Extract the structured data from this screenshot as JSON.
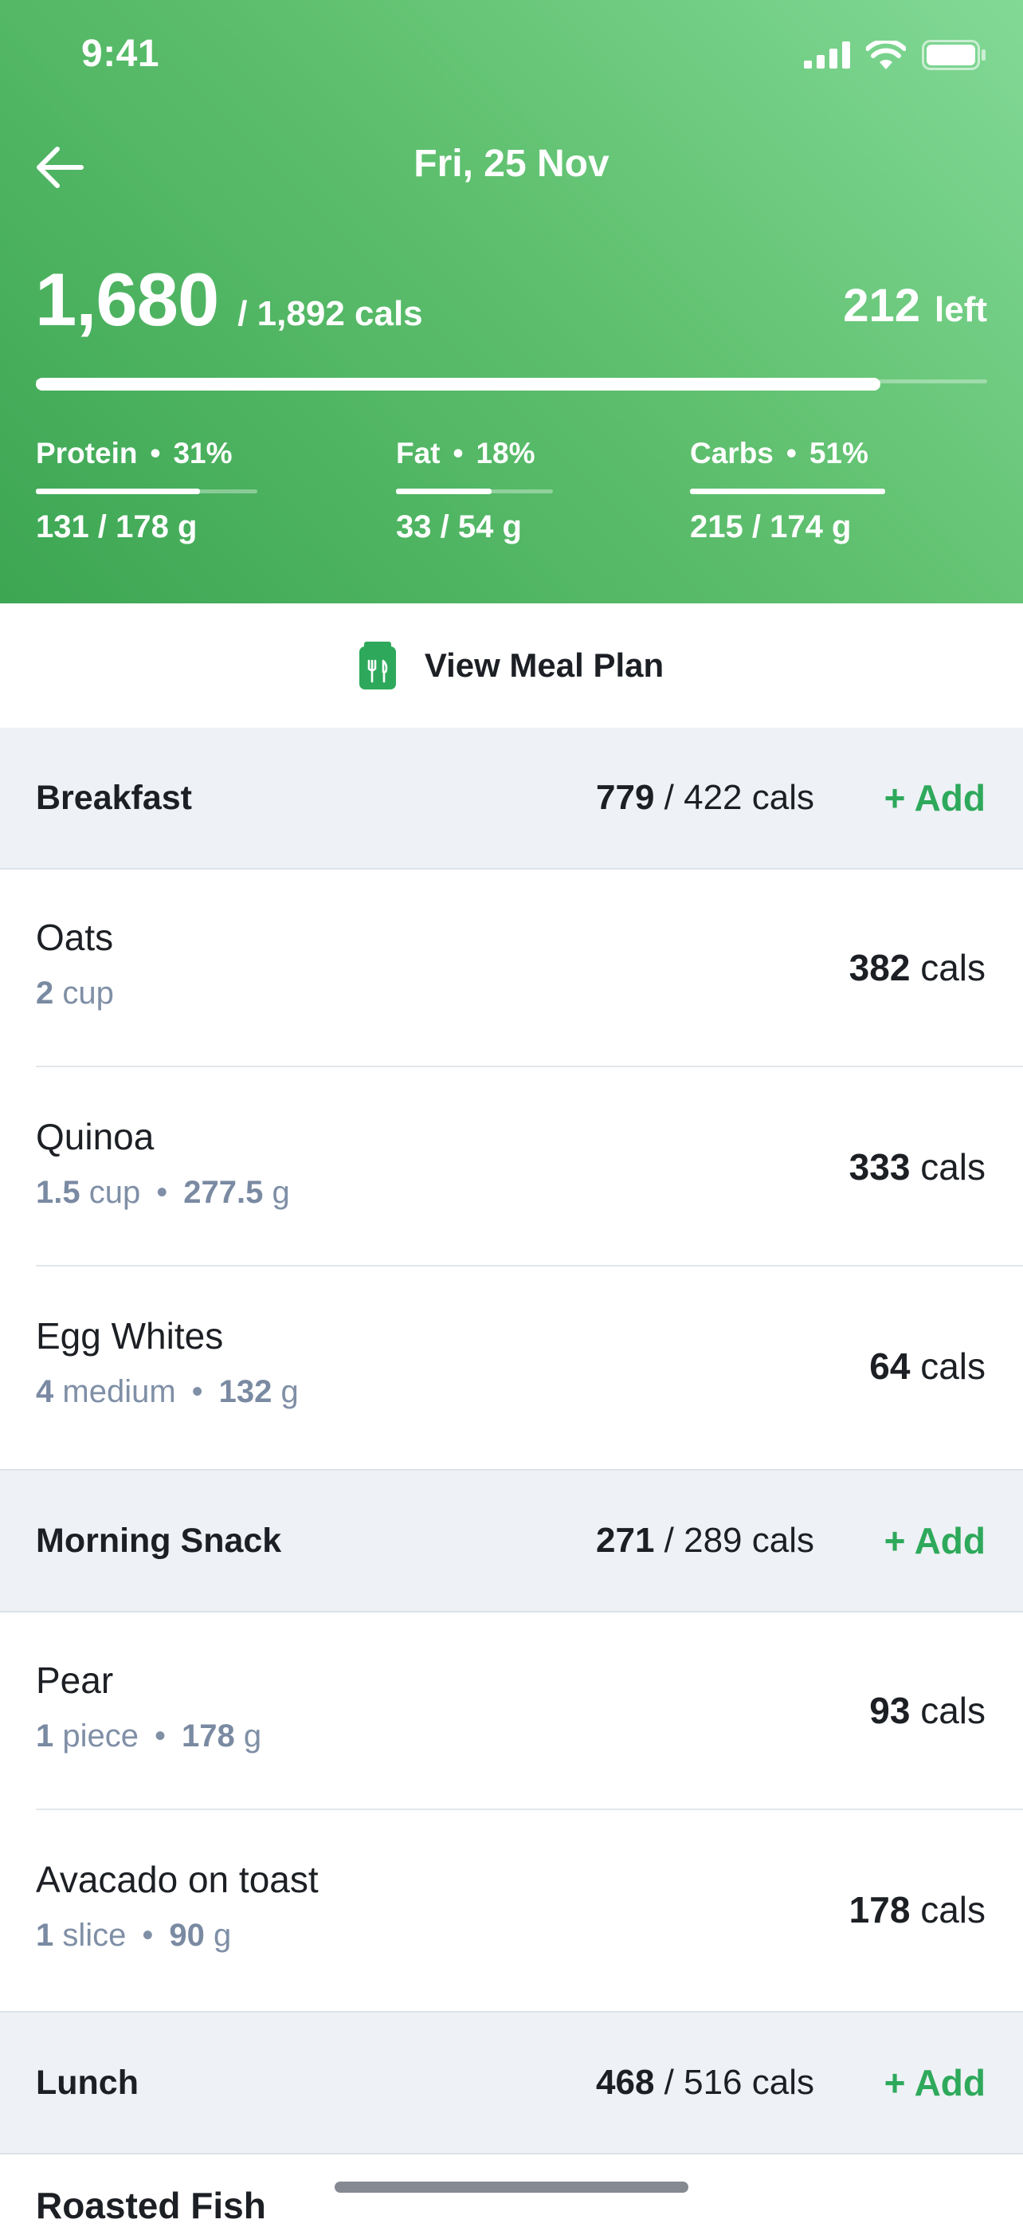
{
  "status": {
    "time": "9:41"
  },
  "header": {
    "date": "Fri, 25 Nov",
    "calories_eaten": "1,680",
    "calories_target": "/ 1,892 cals",
    "calories_left_value": "212",
    "calories_left_label": "left",
    "progress_fraction": 0.888
  },
  "macros": [
    {
      "name": "Protein",
      "percent": "31%",
      "eaten": "131",
      "target": "/ 178 g",
      "fill_fraction": 0.74
    },
    {
      "name": "Fat",
      "percent": "18%",
      "eaten": "33",
      "target": "/ 54 g",
      "fill_fraction": 0.61
    },
    {
      "name": "Carbs",
      "percent": "51%",
      "eaten": "215",
      "target": "/ 174 g",
      "fill_fraction": 1.0
    }
  ],
  "meal_plan": {
    "label": "View Meal Plan"
  },
  "sections": {
    "breakfast": {
      "name": "Breakfast",
      "eaten": "779",
      "target": "/ 422 cals",
      "add": "+ Add"
    },
    "morning_snack": {
      "name": "Morning Snack",
      "eaten": "271",
      "target": "/ 289 cals",
      "add": "+ Add"
    },
    "lunch": {
      "name": "Lunch",
      "eaten": "468",
      "target": "/ 516 cals",
      "add": "+ Add"
    }
  },
  "items": {
    "oats": {
      "name": "Oats",
      "qty": "2",
      "unit": "cup",
      "weight": "",
      "cals": "382",
      "cals_unit": "cals"
    },
    "quinoa": {
      "name": "Quinoa",
      "qty": "1.5",
      "unit": "cup",
      "weight": "277.5",
      "weight_unit": "g",
      "cals": "333",
      "cals_unit": "cals"
    },
    "egg_whites": {
      "name": "Egg Whites",
      "qty": "4",
      "unit": "medium",
      "weight": "132",
      "weight_unit": "g",
      "cals": "64",
      "cals_unit": "cals"
    },
    "pear": {
      "name": "Pear",
      "qty": "1",
      "unit": "piece",
      "weight": "178",
      "weight_unit": "g",
      "cals": "93",
      "cals_unit": "cals"
    },
    "avocado_toast": {
      "name": "Avacado on toast",
      "qty": "1",
      "unit": "slice",
      "weight": "90",
      "weight_unit": "g",
      "cals": "178",
      "cals_unit": "cals"
    }
  },
  "peek_item": {
    "name": "Roasted Fish"
  },
  "colors": {
    "accent_green": "#2ea95b",
    "header_start": "#3ca653",
    "header_end": "#82d996",
    "muted_text": "#7f8fa6"
  }
}
